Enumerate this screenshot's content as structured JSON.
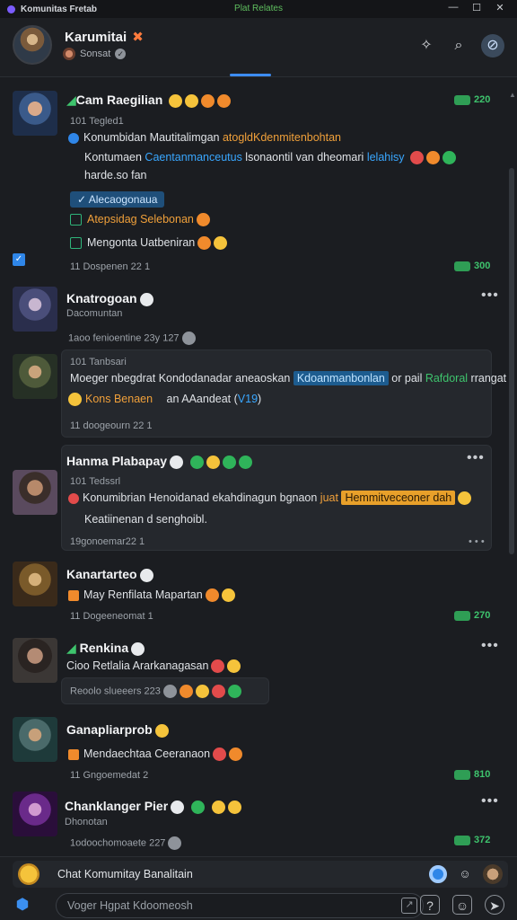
{
  "titlebar": {
    "app_name": "Komunitas Fretab",
    "center": "Plat Relates",
    "controls": [
      "—",
      "☐",
      "✕"
    ]
  },
  "header": {
    "name": "Karumitai",
    "badge": "✖",
    "subtitle": "Sonsat"
  },
  "posts": [
    {
      "name": "Cam Raegilian",
      "reaction_count": "220",
      "sub": "101 Tegled1",
      "line1_text": "Konumbidan Mautitalimgan ",
      "line1_tag": "atogldKdenmitenbohtan",
      "line2_text": "Kontumaen ",
      "line2_tag": "Caentanmanceutus",
      "line2_rest": " lsonaontil van dheomari ",
      "line2_tag2": "lelahisy",
      "line3_text": "harde.so fan",
      "chip": "Alecaogonaua",
      "item1_text": "Atepsidag Selebonan",
      "item2_text": "Mengonta Uatbeniran",
      "meta": "11 Dospenen 22 1",
      "meta_count": "300"
    },
    {
      "name": "Knatrogoan",
      "sub": "Dacomuntan",
      "meta": "1aoo fenioentine 23y 127"
    },
    {
      "sub": "101 Tanbsari",
      "line1_text": "Moeger nbegdrat ",
      "line1_mid": "Kondodanadar aneaoskan ",
      "line1_hl": "Kdoanmanbonlan",
      "line1_rest": " or pail ",
      "line1_green": "Rafdoral",
      "line1_tail": " rrangat",
      "pill": "Kons Benaen",
      "line2_text": "an AAandeat (",
      "line2_tag": "V19",
      "line2_tail": ")",
      "meta": "11 doogeourn 22 1"
    },
    {
      "name": "Hanma Plabapay",
      "sub": "101 Tedssrl",
      "line1_text": "Konumibrian Henoidanad ekahdinagun bgnaon ",
      "line1_tag": "juat",
      "line1_hl": "Hemmitveceoner dah",
      "line2_text": "Keatiinenan d senghoibl.",
      "meta": "19gonoemar22 1"
    },
    {
      "name": "Kanartarteo",
      "line1_text": "May Renfilata Mapartan",
      "meta": "11 Dogeeneomat 1",
      "meta_count": "270"
    },
    {
      "name": "Renkina",
      "line1_text": "Cioo Retlalia Ararkanagasan",
      "meta": "Reoolo slueeers 223"
    },
    {
      "name": "Ganapliarprob",
      "line1_text": "Mendaechtaa Ceeranaon",
      "meta": "11 Gngoemedat 2",
      "meta_count": "810"
    },
    {
      "name": "Chanklanger Pier",
      "sub": "Dhonotan",
      "meta": "1odoochomoaete 227",
      "meta_count": "372"
    }
  ],
  "compose": {
    "row1_text": "Chat Komumitay Banalitain",
    "placeholder": "Voger Hgpat Kdoomeosh"
  },
  "colors": {
    "accent_blue": "#2f86e8",
    "accent_green": "#3ec46d",
    "accent_orange": "#f0a03a",
    "background": "#1b1d21"
  }
}
